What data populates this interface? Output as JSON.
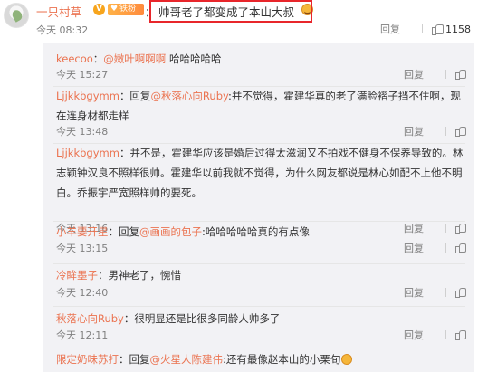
{
  "main_comment": {
    "username": "一只村草",
    "vip_badge": "V",
    "fan_badge": "铁粉",
    "colon": "：",
    "text": "帅哥老了都变成了本山大叔",
    "emoji": "burger-emoji",
    "time": "今天 08:32",
    "reply_label": "回复",
    "like_count": "1158"
  },
  "replies": [
    {
      "username": "keecoo",
      "pre": "：",
      "mention": "@嫩叶啊啊啊",
      "text": " 哈哈哈哈哈",
      "time": "今天 15:27",
      "reply_label": "回复"
    },
    {
      "username": "Ljjkkbgymm",
      "pre": "：回复",
      "mention": "@秋落心向Ruby",
      "text": ":并不觉得，霍建华真的老了满脸褶子挡不住啊，现在连身材都走样",
      "time": "今天 13:48",
      "reply_label": "回复"
    },
    {
      "username": "Ljjkkbgymm",
      "pre": "：",
      "mention": "",
      "text": "并不是，霍建华应该是婚后过得太滋润又不拍戏不健身不保养导致的。林志颖钟汉良不照样很帅。霍建华以前我就不觉得，为什么网友都说是林心如配不上他不明白。乔振宇严宽照样帅的要死。",
      "time": "今天 13:16",
      "reply_label": "回复"
    },
    {
      "username": "小羊要开星",
      "pre": "：回复",
      "mention": "@画画的包子",
      "text": ":哈哈哈哈哈真的有点像",
      "time": "今天 13:15",
      "reply_label": "回复"
    },
    {
      "username": "冷眸墨子",
      "pre": "：",
      "mention": "",
      "text": "男神老了，惋惜",
      "time": "今天 12:40",
      "reply_label": "回复"
    },
    {
      "username": "秋落心向Ruby",
      "pre": "：",
      "mention": "",
      "text": "很明显还是比很多同龄人帅多了",
      "time": "今天 12:11",
      "reply_label": "回复"
    },
    {
      "username": "限定奶味苏打",
      "pre": "：回复",
      "mention": "@火星人陈建伟",
      "text": ":还有最像赵本山的小栗旬",
      "time": "",
      "reply_label": ""
    }
  ],
  "colors": {
    "username": "#eb7350",
    "highlight_box": "#e8262b",
    "reply_bg": "#f2f2f5"
  }
}
